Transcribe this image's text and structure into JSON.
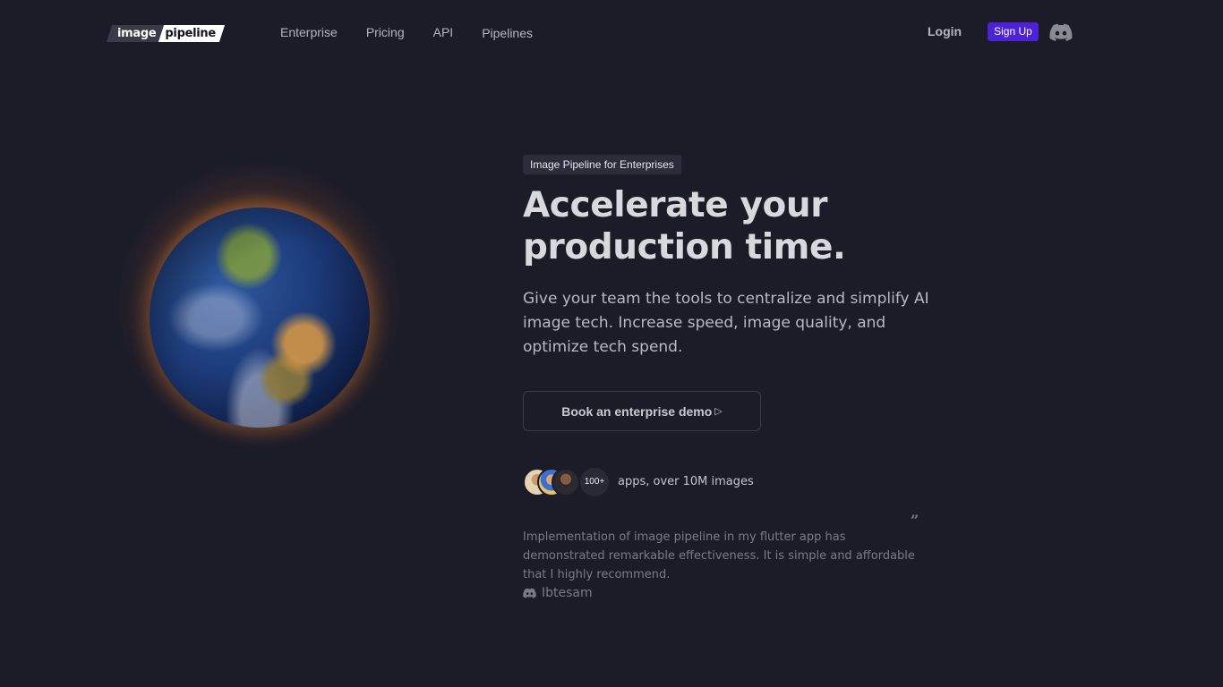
{
  "header": {
    "logo": {
      "part1": "image",
      "part2": "pipeline"
    },
    "nav": [
      "Enterprise",
      "Pricing",
      "API",
      "Pipelines"
    ],
    "login_label": "Login",
    "signup_label": "Sign Up",
    "accent_color": "#4b22d6"
  },
  "hero": {
    "eyebrow": "Image Pipeline for Enterprises",
    "headline_line1": "Accelerate your",
    "headline_line2": "production time.",
    "subtext": "Give your team the tools to centralize and simplify AI image tech. Increase speed, image quality, and optimize tech spend.",
    "cta_label": "Book an enterprise demo",
    "cta_arrow": "▷"
  },
  "social_proof": {
    "count": "100+",
    "text": "apps, over 10M images"
  },
  "testimonial": {
    "quote_mark": "”",
    "text": "Implementation of image pipeline in my flutter app has demonstrated remarkable effectiveness. It is simple and affordable that I highly recommend.",
    "author": "Ibtesam"
  },
  "icons": {
    "discord": "discord-icon",
    "play": "play-arrow-icon",
    "quote": "quote-icon"
  }
}
